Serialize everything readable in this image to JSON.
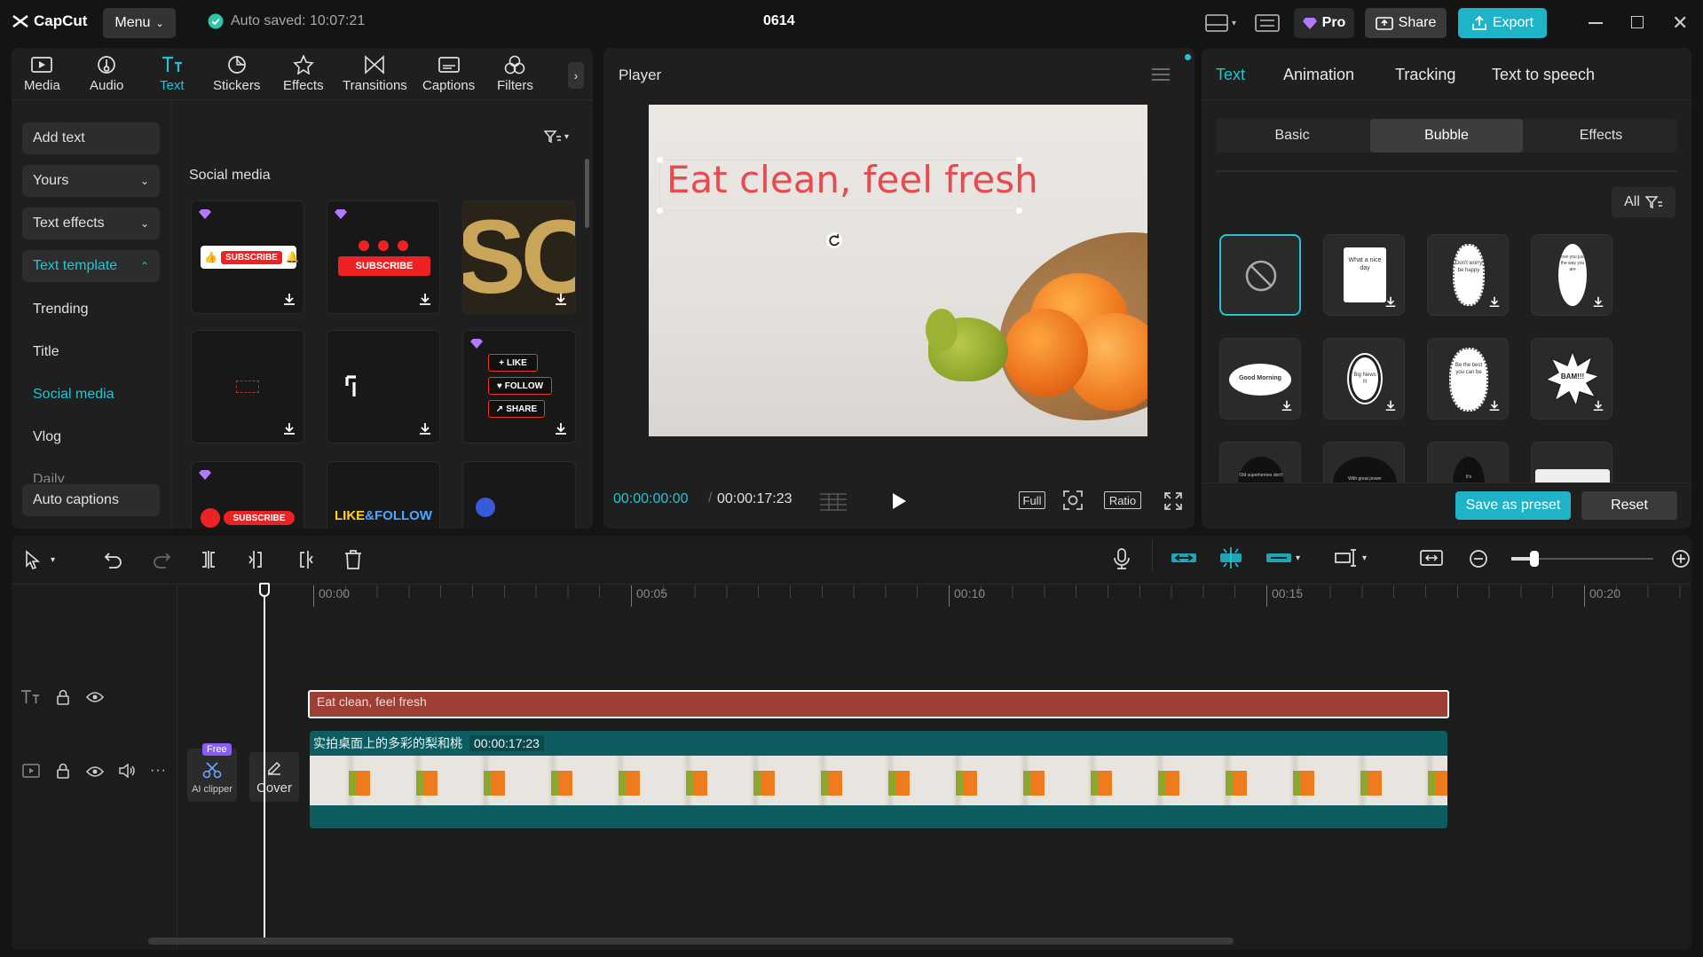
{
  "app": {
    "name": "CapCut",
    "menu_label": "Menu",
    "autosave": "Auto saved: 10:07:21",
    "project_title": "0614",
    "pro_label": "Pro",
    "share_label": "Share",
    "export_label": "Export"
  },
  "toolbar": {
    "tabs": [
      {
        "label": "Media",
        "icon": "media-icon"
      },
      {
        "label": "Audio",
        "icon": "audio-icon"
      },
      {
        "label": "Text",
        "icon": "text-icon"
      },
      {
        "label": "Stickers",
        "icon": "stickers-icon"
      },
      {
        "label": "Effects",
        "icon": "effects-icon"
      },
      {
        "label": "Transitions",
        "icon": "transitions-icon"
      },
      {
        "label": "Captions",
        "icon": "captions-icon"
      },
      {
        "label": "Filters",
        "icon": "filters-icon"
      }
    ],
    "active_tab": "Text"
  },
  "sidebar": {
    "add_text": "Add text",
    "yours": "Yours",
    "text_effects": "Text effects",
    "text_template": "Text template",
    "sub_items": [
      "Trending",
      "Title",
      "Social media",
      "Vlog",
      "Daily"
    ],
    "auto_captions": "Auto captions"
  },
  "content": {
    "section_title": "Social media",
    "card_texts": {
      "subscribe1": "SUBSCRIBE",
      "subscribe2": "SUBSCRIBE",
      "like": "LIKE",
      "follow": "FOLLOW",
      "share": "SHARE",
      "subscribe3": "SUBSCRIBE",
      "like_follow_a": "LIKE",
      "like_follow_b": "&FOLLOW"
    }
  },
  "player": {
    "title": "Player",
    "overlay_text": "Eat clean, feel fresh",
    "current_time": "00:00:00:00",
    "duration": "00:00:17:23",
    "full_label": "Full",
    "ratio_label": "Ratio"
  },
  "right_panel": {
    "tabs": [
      "Text",
      "Animation",
      "Tracking",
      "Text to speech"
    ],
    "active_tab": "Text",
    "subtabs": [
      "Basic",
      "Bubble",
      "Effects"
    ],
    "active_subtab": "Bubble",
    "filter_label": "All",
    "bubble_texts": [
      "What a nice day",
      "Don't worry be happy",
      "love you just the way you are",
      "Good Morning",
      "Big News !!!",
      "Be the best you can be",
      "BAM!!!",
      "Old superheroes don't",
      "With great power",
      "It's",
      ""
    ],
    "save_preset": "Save as preset",
    "reset": "Reset"
  },
  "timeline": {
    "ruler": [
      "00:00",
      "00:05",
      "00:10",
      "00:15",
      "00:20"
    ],
    "text_clip": "Eat clean, feel fresh",
    "video_clip_name": "实拍桌面上的多彩的梨和桃",
    "video_clip_duration": "00:00:17:23",
    "free_badge": "Free",
    "ai_clipper": "AI clipper",
    "cover": "Cover"
  },
  "colors": {
    "accent": "#24c4d4",
    "text_clip": "#9e3f33",
    "video_clip": "#0d5c5f",
    "overlay_text": "#e84a4f"
  }
}
